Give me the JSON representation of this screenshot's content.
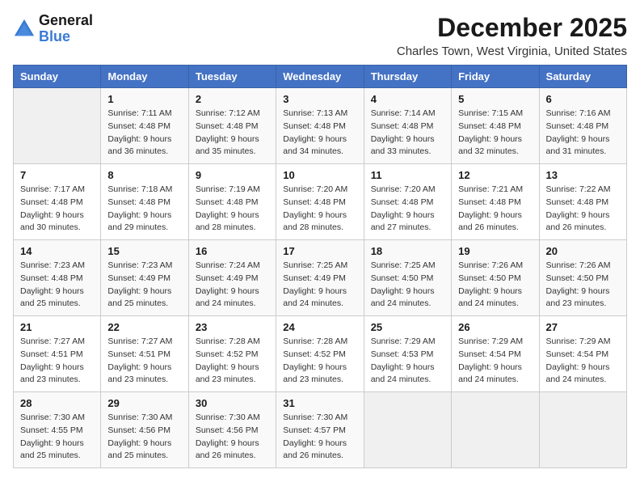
{
  "header": {
    "logo_general": "General",
    "logo_blue": "Blue",
    "month_title": "December 2025",
    "location": "Charles Town, West Virginia, United States"
  },
  "weekdays": [
    "Sunday",
    "Monday",
    "Tuesday",
    "Wednesday",
    "Thursday",
    "Friday",
    "Saturday"
  ],
  "weeks": [
    [
      {
        "day": "",
        "info": ""
      },
      {
        "day": "1",
        "info": "Sunrise: 7:11 AM\nSunset: 4:48 PM\nDaylight: 9 hours\nand 36 minutes."
      },
      {
        "day": "2",
        "info": "Sunrise: 7:12 AM\nSunset: 4:48 PM\nDaylight: 9 hours\nand 35 minutes."
      },
      {
        "day": "3",
        "info": "Sunrise: 7:13 AM\nSunset: 4:48 PM\nDaylight: 9 hours\nand 34 minutes."
      },
      {
        "day": "4",
        "info": "Sunrise: 7:14 AM\nSunset: 4:48 PM\nDaylight: 9 hours\nand 33 minutes."
      },
      {
        "day": "5",
        "info": "Sunrise: 7:15 AM\nSunset: 4:48 PM\nDaylight: 9 hours\nand 32 minutes."
      },
      {
        "day": "6",
        "info": "Sunrise: 7:16 AM\nSunset: 4:48 PM\nDaylight: 9 hours\nand 31 minutes."
      }
    ],
    [
      {
        "day": "7",
        "info": "Sunrise: 7:17 AM\nSunset: 4:48 PM\nDaylight: 9 hours\nand 30 minutes."
      },
      {
        "day": "8",
        "info": "Sunrise: 7:18 AM\nSunset: 4:48 PM\nDaylight: 9 hours\nand 29 minutes."
      },
      {
        "day": "9",
        "info": "Sunrise: 7:19 AM\nSunset: 4:48 PM\nDaylight: 9 hours\nand 28 minutes."
      },
      {
        "day": "10",
        "info": "Sunrise: 7:20 AM\nSunset: 4:48 PM\nDaylight: 9 hours\nand 28 minutes."
      },
      {
        "day": "11",
        "info": "Sunrise: 7:20 AM\nSunset: 4:48 PM\nDaylight: 9 hours\nand 27 minutes."
      },
      {
        "day": "12",
        "info": "Sunrise: 7:21 AM\nSunset: 4:48 PM\nDaylight: 9 hours\nand 26 minutes."
      },
      {
        "day": "13",
        "info": "Sunrise: 7:22 AM\nSunset: 4:48 PM\nDaylight: 9 hours\nand 26 minutes."
      }
    ],
    [
      {
        "day": "14",
        "info": "Sunrise: 7:23 AM\nSunset: 4:48 PM\nDaylight: 9 hours\nand 25 minutes."
      },
      {
        "day": "15",
        "info": "Sunrise: 7:23 AM\nSunset: 4:49 PM\nDaylight: 9 hours\nand 25 minutes."
      },
      {
        "day": "16",
        "info": "Sunrise: 7:24 AM\nSunset: 4:49 PM\nDaylight: 9 hours\nand 24 minutes."
      },
      {
        "day": "17",
        "info": "Sunrise: 7:25 AM\nSunset: 4:49 PM\nDaylight: 9 hours\nand 24 minutes."
      },
      {
        "day": "18",
        "info": "Sunrise: 7:25 AM\nSunset: 4:50 PM\nDaylight: 9 hours\nand 24 minutes."
      },
      {
        "day": "19",
        "info": "Sunrise: 7:26 AM\nSunset: 4:50 PM\nDaylight: 9 hours\nand 24 minutes."
      },
      {
        "day": "20",
        "info": "Sunrise: 7:26 AM\nSunset: 4:50 PM\nDaylight: 9 hours\nand 23 minutes."
      }
    ],
    [
      {
        "day": "21",
        "info": "Sunrise: 7:27 AM\nSunset: 4:51 PM\nDaylight: 9 hours\nand 23 minutes."
      },
      {
        "day": "22",
        "info": "Sunrise: 7:27 AM\nSunset: 4:51 PM\nDaylight: 9 hours\nand 23 minutes."
      },
      {
        "day": "23",
        "info": "Sunrise: 7:28 AM\nSunset: 4:52 PM\nDaylight: 9 hours\nand 23 minutes."
      },
      {
        "day": "24",
        "info": "Sunrise: 7:28 AM\nSunset: 4:52 PM\nDaylight: 9 hours\nand 23 minutes."
      },
      {
        "day": "25",
        "info": "Sunrise: 7:29 AM\nSunset: 4:53 PM\nDaylight: 9 hours\nand 24 minutes."
      },
      {
        "day": "26",
        "info": "Sunrise: 7:29 AM\nSunset: 4:54 PM\nDaylight: 9 hours\nand 24 minutes."
      },
      {
        "day": "27",
        "info": "Sunrise: 7:29 AM\nSunset: 4:54 PM\nDaylight: 9 hours\nand 24 minutes."
      }
    ],
    [
      {
        "day": "28",
        "info": "Sunrise: 7:30 AM\nSunset: 4:55 PM\nDaylight: 9 hours\nand 25 minutes."
      },
      {
        "day": "29",
        "info": "Sunrise: 7:30 AM\nSunset: 4:56 PM\nDaylight: 9 hours\nand 25 minutes."
      },
      {
        "day": "30",
        "info": "Sunrise: 7:30 AM\nSunset: 4:56 PM\nDaylight: 9 hours\nand 26 minutes."
      },
      {
        "day": "31",
        "info": "Sunrise: 7:30 AM\nSunset: 4:57 PM\nDaylight: 9 hours\nand 26 minutes."
      },
      {
        "day": "",
        "info": ""
      },
      {
        "day": "",
        "info": ""
      },
      {
        "day": "",
        "info": ""
      }
    ]
  ]
}
